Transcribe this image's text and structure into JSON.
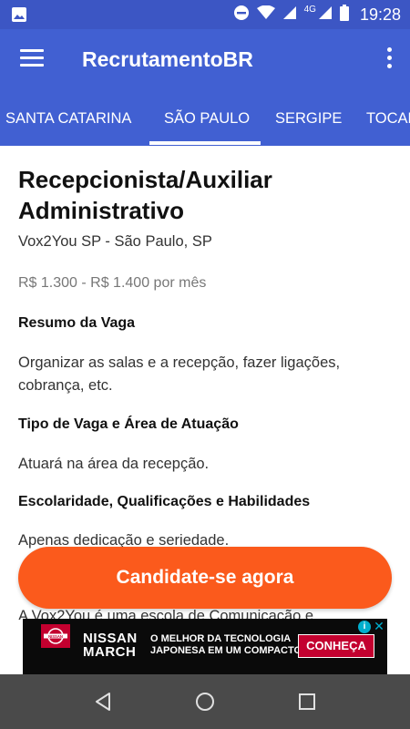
{
  "status_bar": {
    "time": "19:28",
    "network": "4G",
    "icons": [
      "image-icon",
      "do-not-disturb-icon",
      "wifi-icon",
      "signal-icon",
      "signal-4g-icon",
      "battery-icon"
    ]
  },
  "app_bar": {
    "title": "RecrutamentoBR"
  },
  "tabs": [
    {
      "label": "SANTA CATARINA",
      "selected": false
    },
    {
      "label": "SÃO PAULO",
      "selected": true
    },
    {
      "label": "SERGIPE",
      "selected": false
    },
    {
      "label": "TOCANTINS",
      "selected": false
    }
  ],
  "job": {
    "title_line1": "Recepcionista/Auxiliar",
    "title_line2": "Administrativo",
    "company": "Vox2You SP - São Paulo, SP",
    "salary": "R$ 1.300 - R$ 1.400 por mês",
    "sections": [
      {
        "heading": "Resumo da Vaga",
        "text_line1": "Organizar as salas e a recepção, fazer ligações,",
        "text_line2": "cobrança, etc."
      },
      {
        "heading": "Tipo de Vaga e Área de Atuação",
        "text": "Atuará na área da recepção."
      },
      {
        "heading": "Escolaridade, Qualificações e Habilidades",
        "text": "Apenas dedicação e seriedade."
      }
    ],
    "trailing_text": "A Vox2You é uma escola de Comunicação e"
  },
  "cta": {
    "label": "Candidate-se agora"
  },
  "ad": {
    "brand_line1": "NISSAN",
    "brand_line2": "MARCH",
    "tagline_line1": "O MELHOR DA TECNOLOGIA",
    "tagline_line2": "JAPONESA EM UM COMPACTO.",
    "button_label": "CONHEÇA",
    "logo_text": "NISSAN"
  },
  "colors": {
    "status_bar": "#3c56c4",
    "app_bar": "#4160d2",
    "cta": "#fb5a1c",
    "ad_accent": "#c3002f",
    "nav_bar": "#4a4a4a"
  }
}
